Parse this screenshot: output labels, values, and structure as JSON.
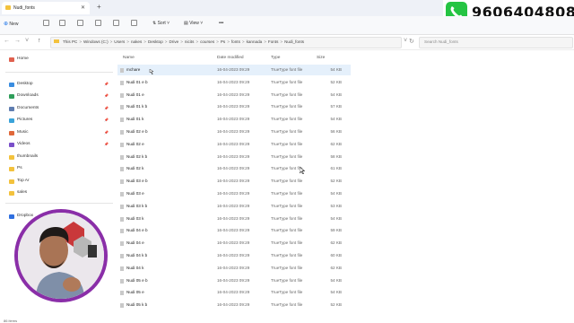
{
  "window": {
    "tab_title": "Nudi_fonts"
  },
  "overlay": {
    "phone_number": "9606404808"
  },
  "toolbar": {
    "new_label": "New",
    "sort_label": "Sort",
    "view_label": "View",
    "more_label": "•••"
  },
  "address": {
    "breadcrumbs": [
      "This PC",
      "Windows (C:)",
      "Users",
      "nakes",
      "Desktop",
      "Drive",
      "nicits",
      "courses",
      "Ps",
      "fonts",
      "kannada",
      "Fonts",
      "Nudi_fonts"
    ],
    "separator": ">"
  },
  "search": {
    "placeholder": "Search Nudi_fonts"
  },
  "sidebar": {
    "items": [
      {
        "label": "Home",
        "icon": "home-icon",
        "color": "#e0604e",
        "pinned": false
      },
      {
        "label": "Desktop",
        "icon": "desktop-icon",
        "color": "#3a8de0",
        "pinned": true
      },
      {
        "label": "Downloads",
        "icon": "downloads-icon",
        "color": "#2f9e5a",
        "pinned": true
      },
      {
        "label": "Documents",
        "icon": "documents-icon",
        "color": "#5f7db0",
        "pinned": true
      },
      {
        "label": "Pictures",
        "icon": "pictures-icon",
        "color": "#3aa3d9",
        "pinned": true
      },
      {
        "label": "Music",
        "icon": "music-icon",
        "color": "#e0683a",
        "pinned": true
      },
      {
        "label": "Videos",
        "icon": "videos-icon",
        "color": "#7a4fc9",
        "pinned": true
      },
      {
        "label": "thumbnails",
        "icon": "folder-icon",
        "color": "#f3c23d",
        "pinned": false
      },
      {
        "label": "Ps",
        "icon": "folder-icon",
        "color": "#f3c23d",
        "pinned": false
      },
      {
        "label": "Top Ar",
        "icon": "folder-icon",
        "color": "#f3c23d",
        "pinned": false
      },
      {
        "label": "sales",
        "icon": "folder-icon",
        "color": "#f3c23d",
        "pinned": false
      },
      {
        "label": "Dropbox",
        "icon": "dropbox-icon",
        "color": "#2f6fe0",
        "pinned": false
      }
    ]
  },
  "columns": {
    "name": "Name",
    "date": "Date modified",
    "type": "Type",
    "size": "Size"
  },
  "files": [
    {
      "name": "mchare",
      "date": "16-04-2023 09:29",
      "type": "TrueType font file",
      "size": "54 KB"
    },
    {
      "name": "Nudi 01 e b",
      "date": "16-04-2023 09:29",
      "type": "TrueType font file",
      "size": "52 KB"
    },
    {
      "name": "Nudi 01 e",
      "date": "16-04-2023 09:29",
      "type": "TrueType font file",
      "size": "54 KB"
    },
    {
      "name": "Nudi 01 k b",
      "date": "16-04-2023 09:29",
      "type": "TrueType font file",
      "size": "57 KB"
    },
    {
      "name": "Nudi 01 k",
      "date": "16-04-2023 09:29",
      "type": "TrueType font file",
      "size": "54 KB"
    },
    {
      "name": "Nudi 02 e b",
      "date": "16-04-2023 09:29",
      "type": "TrueType font file",
      "size": "56 KB"
    },
    {
      "name": "Nudi 02 e",
      "date": "16-04-2023 09:29",
      "type": "TrueType font file",
      "size": "62 KB"
    },
    {
      "name": "Nudi 02 k b",
      "date": "16-04-2023 09:29",
      "type": "TrueType font file",
      "size": "58 KB"
    },
    {
      "name": "Nudi 02 k",
      "date": "16-04-2023 09:29",
      "type": "TrueType font file",
      "size": "61 KB"
    },
    {
      "name": "Nudi 03 e b",
      "date": "16-04-2023 09:29",
      "type": "TrueType font file",
      "size": "52 KB"
    },
    {
      "name": "Nudi 03 e",
      "date": "16-04-2023 09:29",
      "type": "TrueType font file",
      "size": "54 KB"
    },
    {
      "name": "Nudi 03 k b",
      "date": "16-04-2023 09:29",
      "type": "TrueType font file",
      "size": "53 KB"
    },
    {
      "name": "Nudi 03 k",
      "date": "16-04-2023 09:29",
      "type": "TrueType font file",
      "size": "54 KB"
    },
    {
      "name": "Nudi 04 e b",
      "date": "16-04-2023 09:29",
      "type": "TrueType font file",
      "size": "59 KB"
    },
    {
      "name": "Nudi 04 e",
      "date": "16-04-2023 09:29",
      "type": "TrueType font file",
      "size": "62 KB"
    },
    {
      "name": "Nudi 04 k b",
      "date": "16-04-2023 09:29",
      "type": "TrueType font file",
      "size": "60 KB"
    },
    {
      "name": "Nudi 04 k",
      "date": "16-04-2023 09:29",
      "type": "TrueType font file",
      "size": "62 KB"
    },
    {
      "name": "Nudi 05 e b",
      "date": "16-04-2023 09:29",
      "type": "TrueType font file",
      "size": "54 KB"
    },
    {
      "name": "Nudi 05 e",
      "date": "16-04-2023 09:29",
      "type": "TrueType font file",
      "size": "54 KB"
    },
    {
      "name": "Nudi 05 k b",
      "date": "16-04-2023 09:29",
      "type": "TrueType font file",
      "size": "52 KB"
    }
  ],
  "status": {
    "items_text": "86 items"
  }
}
